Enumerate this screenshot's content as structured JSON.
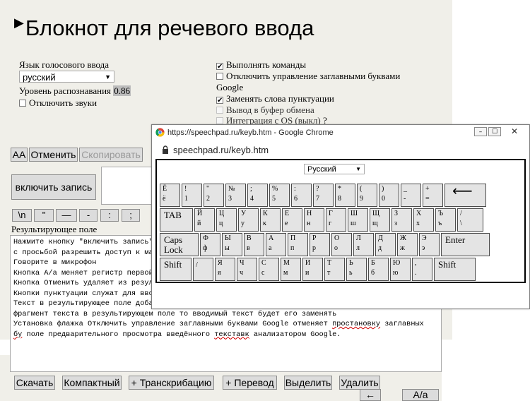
{
  "header": {
    "title": "Блокнот для речевого ввода"
  },
  "settings": {
    "lang_label": "Язык голосового ввода",
    "lang_value": "русский",
    "recog_label": "Уровень распознавания",
    "recog_value": "0.86",
    "mute_label": "Отключить звуки",
    "mute_checked": false
  },
  "options": {
    "exec_commands": "Выполнять команды",
    "exec_commands_checked": true,
    "disable_caps": "Отключить управление заглавными буквами",
    "disable_caps_checked": false,
    "google_label": "Google",
    "replace_punct": "Заменять слова пунктуации",
    "replace_punct_checked": true,
    "clipboard": "Вывод в буфер обмена",
    "os_integration": "Интеграция с OS (выкл)",
    "help": "?"
  },
  "toolbar": {
    "case": "AA",
    "undo": "Отменить",
    "copy": "Скопировать"
  },
  "record": {
    "label": "включить запись"
  },
  "punct_buttons": [
    "\\n",
    "\"",
    "—",
    "-",
    ":",
    ";"
  ],
  "result": {
    "label": "Результирующее поле",
    "lines": [
      "Нажмите кнопку \"включить запись\"",
      "с просьбой разрешить доступ к ма",
      "Говорите в микрофон",
      "Кнопка А/а меняет регистр первой",
      "Кнопка Отменить удаляет из резул",
      "Кнопки пунктуации служат для вво",
      "Текст в результирующее поле доба",
      "фрагмент текста в результирующем поле то вводимый текст будет его заменять"
    ],
    "line9": {
      "a": "Установка флажка Отключить управление заглавными буквами Google отменяет ",
      "b": "простановку",
      "c": " заглавных"
    },
    "line10": {
      "a": "бу",
      "b": " поле предварительного просмотра введённого ",
      "c": "текставк",
      "d": " анализатором Google."
    }
  },
  "bottom_buttons": [
    "Скачать",
    "Компактный",
    "+ Транскрибацию",
    "+ Перевод",
    "Выделить",
    "Удалить"
  ],
  "bottom_right": {
    "back": "←",
    "case": "А/а"
  },
  "popup": {
    "window_title": "https://speechpad.ru/keyb.htm - Google Chrome",
    "url": "speechpad.ru/keyb.htm",
    "lang_select": "Русский",
    "rows": [
      [
        {
          "t": "Ё",
          "b": "ё"
        },
        {
          "t": "!",
          "b": "1"
        },
        {
          "t": "\"",
          "b": "2"
        },
        {
          "t": "№",
          "b": "3"
        },
        {
          "t": ";",
          "b": "4"
        },
        {
          "t": "%",
          "b": "5"
        },
        {
          "t": ":",
          "b": "6"
        },
        {
          "t": "?",
          "b": "7"
        },
        {
          "t": "*",
          "b": "8"
        },
        {
          "t": "(",
          "b": "9"
        },
        {
          "t": ")",
          "b": "0"
        },
        {
          "t": "_",
          "b": "-"
        },
        {
          "t": "+",
          "b": "="
        },
        {
          "t": "⟵",
          "b": ""
        }
      ],
      [
        {
          "t": "TAB",
          "b": ""
        },
        {
          "t": "Й",
          "b": "й"
        },
        {
          "t": "Ц",
          "b": "ц"
        },
        {
          "t": "У",
          "b": "у"
        },
        {
          "t": "К",
          "b": "к"
        },
        {
          "t": "Е",
          "b": "е"
        },
        {
          "t": "Н",
          "b": "н"
        },
        {
          "t": "Г",
          "b": "г"
        },
        {
          "t": "Ш",
          "b": "ш"
        },
        {
          "t": "Щ",
          "b": "щ"
        },
        {
          "t": "З",
          "b": "з"
        },
        {
          "t": "Х",
          "b": "х"
        },
        {
          "t": "Ъ",
          "b": "ъ"
        },
        {
          "t": "/",
          "b": "\\"
        }
      ],
      [
        {
          "t": "Caps",
          "b": "Lock"
        },
        {
          "t": "Ф",
          "b": "ф"
        },
        {
          "t": "Ы",
          "b": "ы"
        },
        {
          "t": "В",
          "b": "в"
        },
        {
          "t": "А",
          "b": "а"
        },
        {
          "t": "П",
          "b": "п"
        },
        {
          "t": "Р",
          "b": "р"
        },
        {
          "t": "О",
          "b": "о"
        },
        {
          "t": "Л",
          "b": "л"
        },
        {
          "t": "Д",
          "b": "д"
        },
        {
          "t": "Ж",
          "b": "ж"
        },
        {
          "t": "Э",
          "b": "э"
        },
        {
          "t": "Enter",
          "b": ""
        }
      ],
      [
        {
          "t": "Shift",
          "b": ""
        },
        {
          "t": "",
          "b": "/"
        },
        {
          "t": "Я",
          "b": "я"
        },
        {
          "t": "Ч",
          "b": "ч"
        },
        {
          "t": "С",
          "b": "с"
        },
        {
          "t": "М",
          "b": "м"
        },
        {
          "t": "И",
          "b": "и"
        },
        {
          "t": "Т",
          "b": "т"
        },
        {
          "t": "Ь",
          "b": "ь"
        },
        {
          "t": "Б",
          "b": "б"
        },
        {
          "t": "Ю",
          "b": "ю"
        },
        {
          "t": ",",
          "b": "."
        },
        {
          "t": "Shift",
          "b": ""
        }
      ]
    ]
  }
}
